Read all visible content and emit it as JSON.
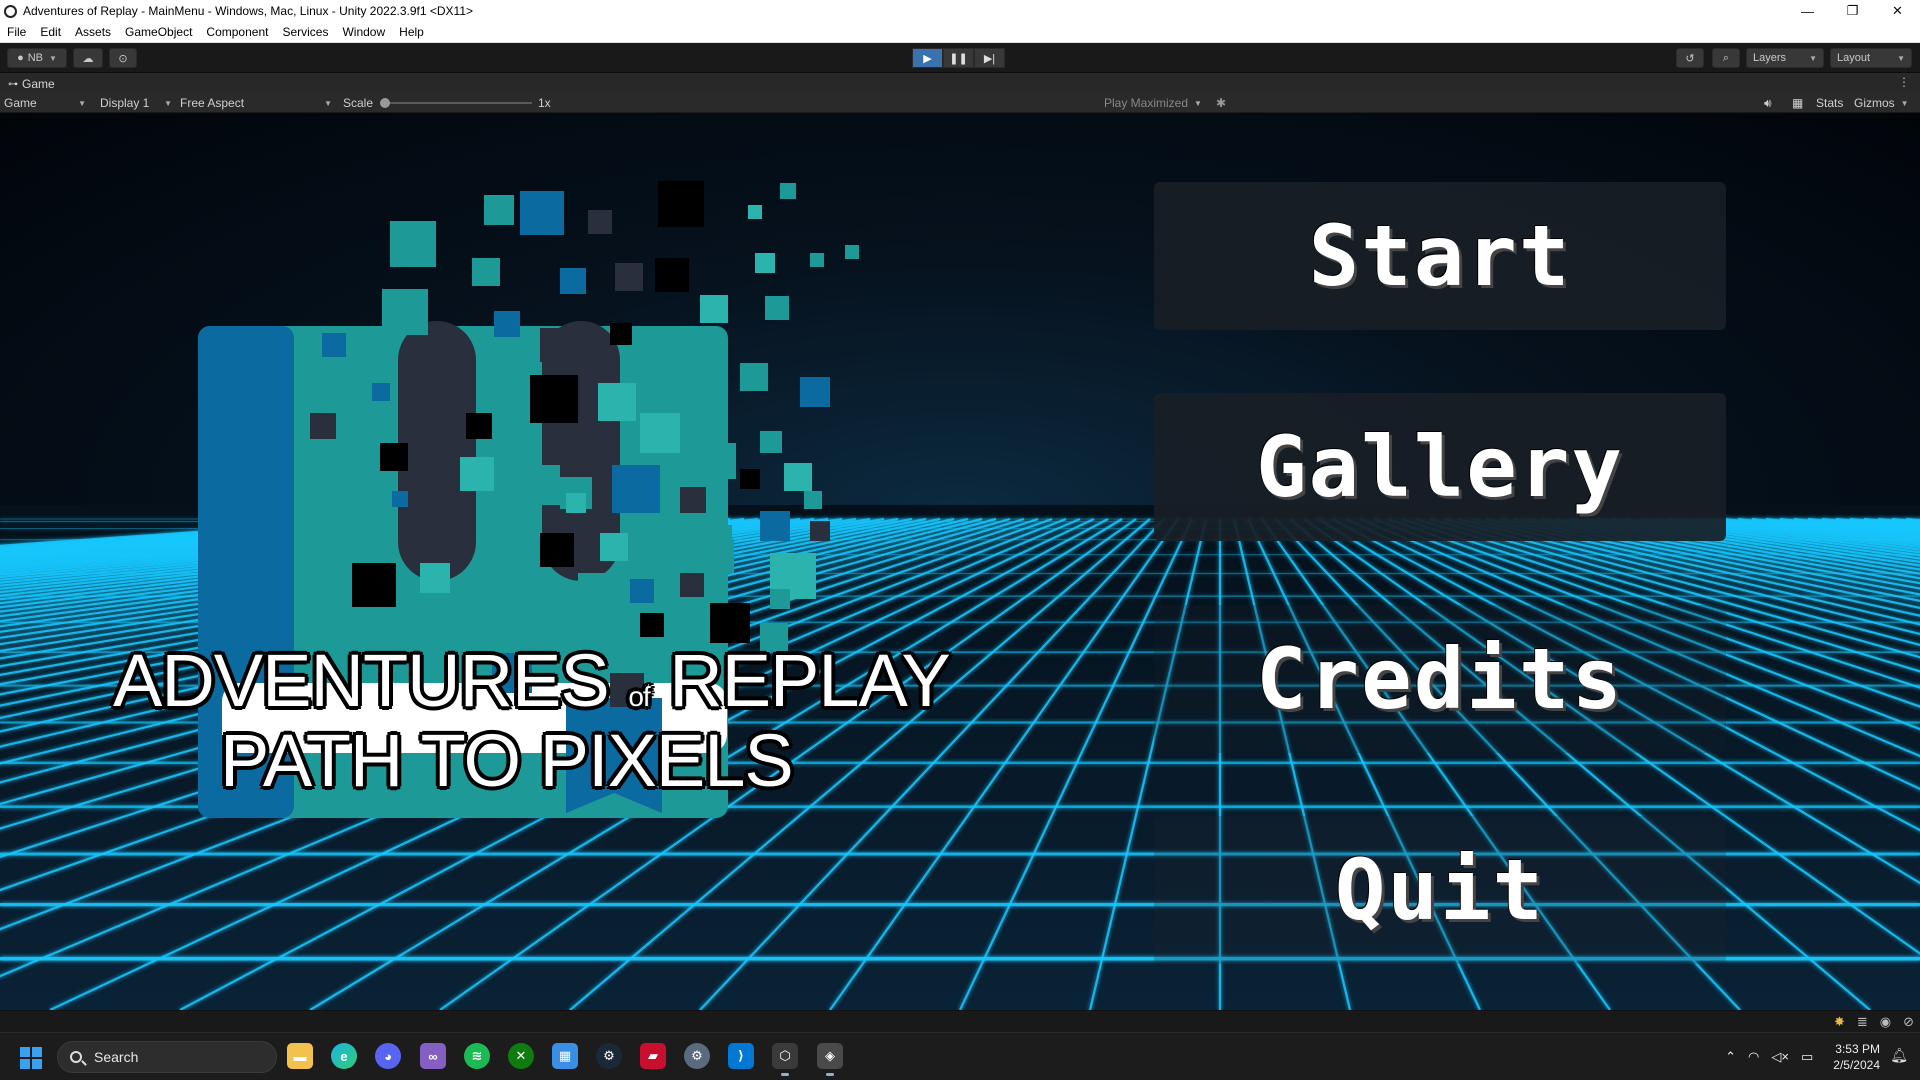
{
  "window": {
    "title": "Adventures of Replay - MainMenu - Windows, Mac, Linux - Unity 2022.3.9f1 <DX11>",
    "controls": [
      "—",
      "❐",
      "✕"
    ]
  },
  "menubar": [
    "File",
    "Edit",
    "Assets",
    "GameObject",
    "Component",
    "Services",
    "Window",
    "Help"
  ],
  "toolbar": {
    "account": "NB",
    "layers": "Layers",
    "layout": "Layout",
    "play": "▶",
    "pause": "❚❚",
    "step": "▶|"
  },
  "game_tab": {
    "label": "Game"
  },
  "game_bar": {
    "view": "Game",
    "display": "Display 1",
    "aspect": "Free Aspect",
    "scale_label": "Scale",
    "scale_value": "1x",
    "play_mode": "Play Maximized",
    "stats": "Stats",
    "gizmos": "Gizmos"
  },
  "game": {
    "title_line1_a": "ADVENTURES",
    "title_line1_of": "of",
    "title_line1_b": "REPLAY",
    "title_line2": "PATH TO PIXELS",
    "buttons": {
      "start": "Start",
      "gallery": "Gallery",
      "credits": "Credits",
      "quit": "Quit"
    },
    "colors": {
      "teal": "#1d9a98",
      "blue": "#0b6aa0",
      "dark": "#2a2f3d",
      "grid": "#17c8ff"
    }
  },
  "taskbar": {
    "search_placeholder": "Search",
    "time": "3:53 PM",
    "date": "2/5/2024",
    "apps": [
      "file-explorer",
      "edge",
      "discord",
      "visual-studio",
      "spotify",
      "xbox",
      "store",
      "steam",
      "app-red",
      "settings",
      "vscode",
      "unity-hub",
      "unity"
    ]
  }
}
